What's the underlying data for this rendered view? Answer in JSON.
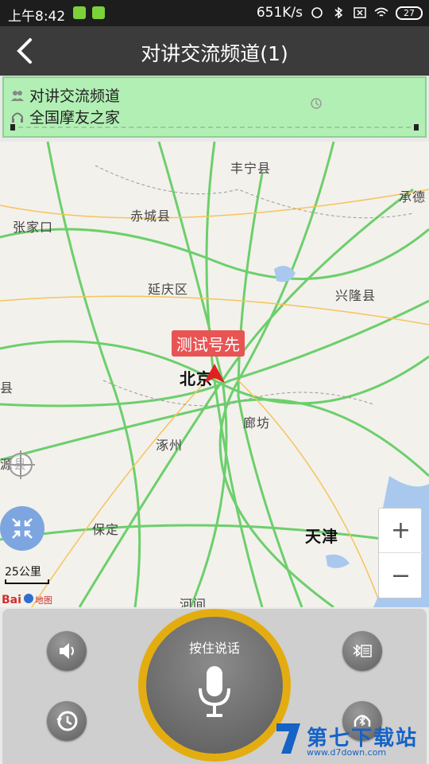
{
  "status_bar": {
    "time": "上午8:42",
    "net_speed": "651K/s",
    "battery": "27"
  },
  "header": {
    "title": "对讲交流频道(1)"
  },
  "channel": {
    "name": "对讲交流频道",
    "group": "全国摩友之家"
  },
  "map": {
    "marker_label": "测试号先",
    "cities": {
      "fengning": "丰宁县",
      "chengde": "承德",
      "chicheng": "赤城县",
      "zhangjiakou": "张家口",
      "yanqing": "延庆区",
      "xinglong": "兴隆县",
      "beijing": "北京",
      "langfang": "廊坊",
      "zhuozhou": "涿州",
      "baoding": "保定",
      "tianjin": "天津",
      "hejian": "河间",
      "yuanxian": "源县",
      "xian_left": "县"
    },
    "zoom_in": "+",
    "zoom_out": "−",
    "scale": "25公里",
    "logo": "Baidu地图"
  },
  "controls": {
    "ptt_label": "按住说话"
  },
  "watermark": {
    "text": "第七下载站",
    "url": "www.d7down.com"
  },
  "colors": {
    "status_bg": "#1d1d1d",
    "title_bg": "#3b3b3b",
    "channel_bg": "#b2efb4",
    "ptt_ring": "#e3ad12",
    "marker_red": "#e85454",
    "road_green": "#6ccf6c"
  }
}
